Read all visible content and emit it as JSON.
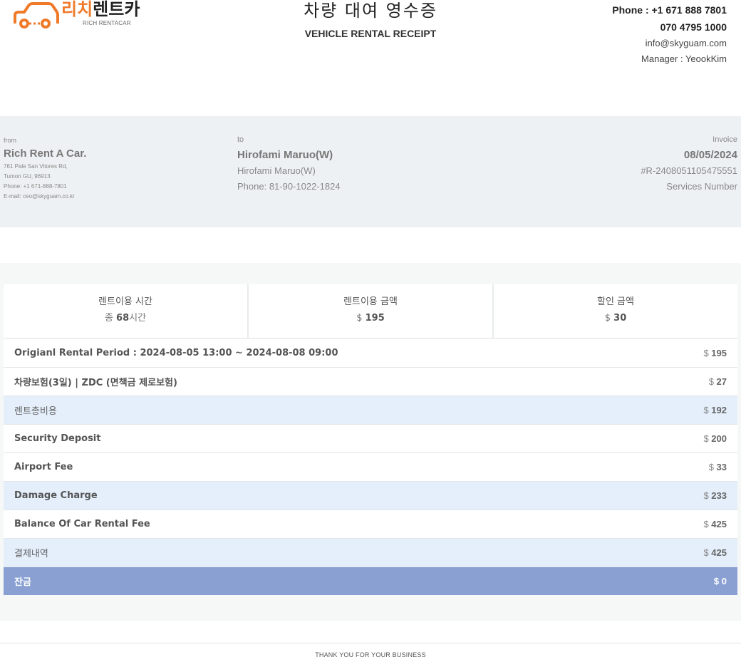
{
  "header": {
    "logo": {
      "korean_orange": "리치",
      "korean_black": "렌트카",
      "english": "RICH RENTACAR"
    },
    "title_ko": "차량 대여 영수증",
    "title_en": "VEHICLE RENTAL RECEIPT",
    "contact": {
      "phone": "Phone : +1 671 888 7801",
      "phone2": "070 4795 1000",
      "email": "info@skyguam.com",
      "manager": "Manager : YeookKim"
    }
  },
  "info": {
    "from": {
      "label": "from",
      "name": "Rich Rent A Car.",
      "address1": "761 Pale San Vitores Rd,",
      "address2": "Tumon GU, 96913",
      "phone": "Phone: +1 671-888-7801",
      "email": "E-mail: ceo@skyguam.co.kr"
    },
    "to": {
      "label": "to",
      "name": "Hirofami Maruo(W)",
      "sub": "Hirofami Maruo(W)",
      "phone": "Phone: 81-90-1022-1824"
    },
    "invoice": {
      "label": "Invoice",
      "date": "08/05/2024",
      "number": "#R-2408051105475551",
      "services": "Services Number"
    }
  },
  "summary": [
    {
      "title": "렌트이용 시간",
      "prefix": "종 ",
      "value": "68",
      "suffix": "시간"
    },
    {
      "title": "렌트이용 금액",
      "prefix": "$ ",
      "value": "195",
      "suffix": ""
    },
    {
      "title": "할인 금액",
      "prefix": "$ ",
      "value": "30",
      "suffix": ""
    }
  ],
  "rows": [
    {
      "label": "Origianl Rental Period : 2024-08-05 13:00 ~ 2024-08-08 09:00",
      "currency": "$ ",
      "amount": "195"
    },
    {
      "label": "차량보험(3일) | ZDC (면책금 제로보험)",
      "currency": "$ ",
      "amount": "27"
    },
    {
      "label": "렌트총비용",
      "currency": "$ ",
      "amount": "192"
    },
    {
      "label": "Security Deposit",
      "currency": "$ ",
      "amount": "200"
    },
    {
      "label": "Airport Fee",
      "currency": "$ ",
      "amount": "33"
    },
    {
      "label": "Damage Charge",
      "currency": "$ ",
      "amount": "233"
    },
    {
      "label": "Balance Of Car Rental Fee",
      "currency": "$ ",
      "amount": "425"
    },
    {
      "label": "결제내역",
      "currency": "$ ",
      "amount": "425"
    },
    {
      "label": "잔금",
      "currency": "$ ",
      "amount": "0"
    }
  ],
  "footer": "THANK YOU FOR YOUR BUSINESS",
  "colors": {
    "logo_orange": "#ee7a2a",
    "info_band": "#eef1f3",
    "highlight_row": "#e4effb",
    "final_row": "#8aa0d2"
  }
}
